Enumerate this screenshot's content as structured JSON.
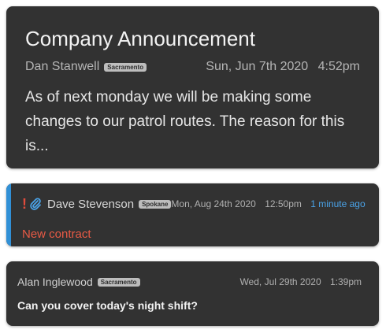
{
  "announcement": {
    "title": "Company Announcement",
    "author": "Dan Stanwell",
    "location_badge": "Sacramento",
    "date": "Sun, Jun 7th 2020",
    "time": "4:52pm",
    "body": "As of next monday we will be making some changes to our patrol routes. The reason for this is..."
  },
  "message_urgent": {
    "priority_mark": "!",
    "author": "Dave Stevenson",
    "location_badge": "Spokane",
    "date": "Mon, Aug 24th 2020",
    "time": "12:50pm",
    "relative_time": "1 minute ago",
    "subject": "New contract",
    "accent_color": "#3190d6",
    "priority_color": "#e04b3c",
    "icons": [
      "exclamation-icon",
      "paperclip-icon"
    ]
  },
  "message_plain": {
    "author": "Alan Inglewood",
    "location_badge": "Sacramento",
    "date": "Wed, Jul 29th 2020",
    "time": "1:39pm",
    "body": "Can you cover today's night shift?"
  }
}
